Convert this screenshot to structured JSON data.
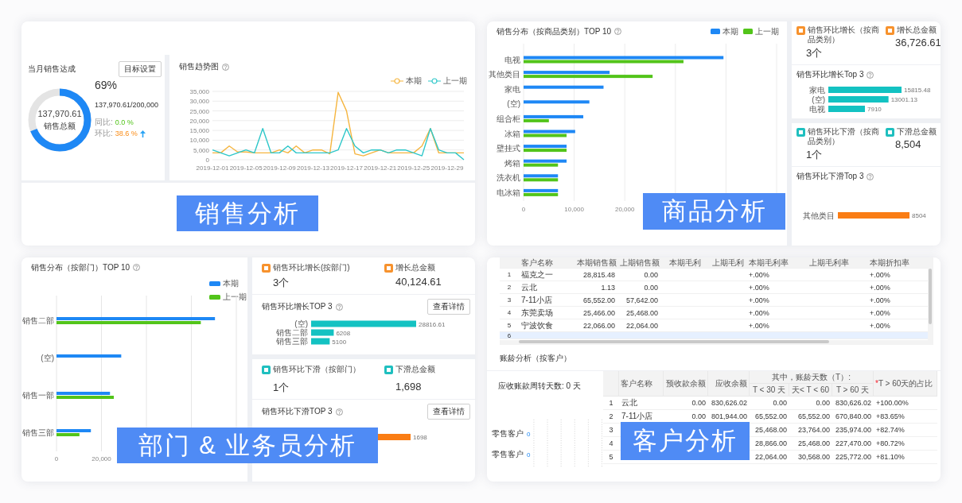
{
  "sales": {
    "caption": "销售分析",
    "target": {
      "title": "当月销售达成",
      "button": "目标设置",
      "level": 0.69,
      "total": "137,970.61",
      "total_label": "销售总额",
      "percent": "69%",
      "progress": "137,970.61/200,000",
      "comparisons": [
        {
          "label": "同比:",
          "value": "0.0 %",
          "up": false
        },
        {
          "label": "环比:",
          "value": "38.6 %",
          "up": true
        }
      ]
    },
    "trend": {
      "title": "销售趋势图",
      "chart_data": {
        "type": "line",
        "categories": [
          "2019-12-01",
          null,
          null,
          null,
          "2019-12-05",
          null,
          null,
          null,
          "2019-12-09",
          null,
          null,
          null,
          "2019-12-13",
          null,
          null,
          null,
          "2019-12-17",
          null,
          null,
          null,
          "2019-12-21",
          null,
          null,
          null,
          "2019-12-25",
          null,
          null,
          null,
          "2019-12-29",
          null,
          null
        ],
        "series": [
          {
            "name": "本期",
            "color": "#f5b53f",
            "values": [
              3500,
              3500,
              7000,
              4000,
              4000,
              3500,
              3500,
              3500,
              5000,
              3500,
              7000,
              3500,
              5000,
              5000,
              3000,
              34500,
              25000,
              3000,
              2000,
              3500,
              5000,
              3500,
              3500,
              3500,
              3500,
              7000,
              16000,
              3500,
              3500,
              3500,
              3500
            ]
          },
          {
            "name": "上一期",
            "color": "#2ec7c9",
            "values": [
              5000,
              3500,
              2000,
              3500,
              5000,
              3500,
              16000,
              3500,
              3500,
              7000,
              3500,
              3500,
              3500,
              3500,
              3500,
              5000,
              16000,
              7000,
              3500,
              5000,
              5000,
              3500,
              5000,
              5000,
              3500,
              2000,
              16000,
              5000,
              3500,
              3500,
              0
            ]
          }
        ],
        "ylim": [
          0,
          35000
        ],
        "grid": true,
        "yticks": [
          {
            "value": 0,
            "label": "0"
          },
          {
            "value": 5000,
            "label": "5,000"
          },
          {
            "value": 10000,
            "label": "10,000"
          },
          {
            "value": 15000,
            "label": "15,000"
          },
          {
            "value": 20000,
            "label": "20,000"
          },
          {
            "value": 25000,
            "label": "25,000"
          },
          {
            "value": 30000,
            "label": "30,000"
          },
          {
            "value": 35000,
            "label": "35,000"
          }
        ]
      }
    }
  },
  "products": {
    "caption": "商品分析",
    "distribution": {
      "title": "销售分布（按商品类别）TOP 10",
      "chart_data": {
        "type": "bar",
        "orientation": "horizontal",
        "categories": [
          "电视",
          "其他类目",
          "家电",
          "(空)",
          "组合柜",
          "冰箱",
          "壁挂式",
          "烤箱",
          "洗衣机",
          "电冰箱"
        ],
        "series": [
          {
            "name": "本期",
            "color": "#1e88f5",
            "values": [
              39500,
              17000,
              15800,
              13000,
              11800,
              10200,
              8500,
              8500,
              6800,
              6800
            ]
          },
          {
            "name": "上一期",
            "color": "#52c41a",
            "values": [
              31600,
              25500,
              null,
              null,
              5000,
              8500,
              8500,
              6800,
              6800,
              6800
            ]
          }
        ],
        "xlim": [
          0,
          50000
        ],
        "xticks": [
          {
            "value": 0,
            "label": "0"
          },
          {
            "value": 10000,
            "label": "10,000"
          },
          {
            "value": 20000,
            "label": "20,000"
          }
        ]
      }
    },
    "growth": {
      "declining": false,
      "count_label": "销售环比增长（按商品类别）",
      "amount_label": "增长总金额",
      "count": "3个",
      "amount": "36,726.61",
      "top_title": "销售环比增长Top 3",
      "chart_data": {
        "type": "bar",
        "orientation": "horizontal",
        "categories": [
          "家电",
          "(空)",
          "电视"
        ],
        "series": [
          {
            "color": "#13c2c2",
            "values": [
              15815.48,
              13001.13,
              7910
            ]
          }
        ],
        "data_labels": true
      }
    },
    "decline": {
      "declining": true,
      "count_label": "销售环比下滑（按商品类别）",
      "amount_label": "下滑总金额",
      "count": "1个",
      "amount": "8,504",
      "top_title": "销售环比下滑Top 3",
      "chart_data": {
        "type": "bar",
        "orientation": "horizontal",
        "categories": [
          "其他类目"
        ],
        "series": [
          {
            "color": "#fa7d14",
            "values": [
              8504
            ]
          }
        ],
        "data_labels": true
      }
    }
  },
  "departments": {
    "caption": "部门 & 业务员分析",
    "distribution": {
      "title": "销售分布（按部门）TOP 10",
      "chart_data": {
        "type": "bar",
        "orientation": "horizontal",
        "categories": [
          "销售二部",
          "(空)",
          "销售一部",
          "销售三部"
        ],
        "series": [
          {
            "name": "本期",
            "color": "#1e88f5",
            "values": [
              70500,
              28800,
              23800,
              15300
            ]
          },
          {
            "name": "上一期",
            "color": "#52c41a",
            "values": [
              64200,
              null,
              25500,
              10200
            ]
          }
        ],
        "xlim": [
          0,
          80000
        ],
        "xticks": [
          {
            "value": 0,
            "label": "0"
          },
          {
            "value": 20000,
            "label": "20,000"
          }
        ]
      }
    },
    "growth": {
      "declining": false,
      "count_label": "销售环比增长(按部门)",
      "amount_label": "增长总金额",
      "count": "3个",
      "amount": "40,124.61",
      "top_title": "销售环比增长TOP 3",
      "detail_button": "查看详情",
      "chart_data": {
        "type": "bar",
        "orientation": "horizontal",
        "categories": [
          "(空)",
          "销售二部",
          "销售三部"
        ],
        "series": [
          {
            "color": "#13c2c2",
            "values": [
              28816.61,
              6208,
              5100
            ]
          }
        ],
        "data_labels": true
      }
    },
    "decline": {
      "declining": true,
      "count_label": "销售环比下滑（按部门）",
      "amount_label": "下滑总金额",
      "count": "1个",
      "amount": "1,698",
      "top_title": "销售环比下滑TOP 3",
      "detail_button": "查看详情",
      "top_value": "1698"
    }
  },
  "customers": {
    "caption": "客户分析",
    "sales_table": {
      "columns": [
        "客户名称",
        "本期销售额",
        "上期销售额",
        "本期毛利",
        "上期毛利",
        "本期毛利率",
        "上期毛利率",
        "本期折扣率"
      ],
      "rows": [
        {
          "index": "1",
          "selected": false,
          "cells": [
            "福克之一",
            "28,815.48",
            "0.00",
            null,
            null,
            "+.00%",
            null,
            "+.00%"
          ]
        },
        {
          "index": "2",
          "selected": false,
          "cells": [
            "云北",
            "1.13",
            "0.00",
            null,
            null,
            "+.00%",
            null,
            "+.00%"
          ]
        },
        {
          "index": "3",
          "selected": false,
          "cells": [
            "7-11小店",
            "65,552.00",
            "57,642.00",
            null,
            null,
            "+.00%",
            null,
            "+.00%"
          ]
        },
        {
          "index": "4",
          "selected": false,
          "cells": [
            "东莞卖场",
            "25,466.00",
            "25,468.00",
            null,
            null,
            "+.00%",
            null,
            "+.00%"
          ]
        },
        {
          "index": "5",
          "selected": false,
          "cells": [
            "宁波饮食",
            "22,066.00",
            "22,064.00",
            null,
            null,
            "+.00%",
            null,
            "+.00%"
          ]
        },
        {
          "index": "6",
          "selected": true
        }
      ]
    },
    "aging": {
      "title": "账龄分析（按客户）",
      "turnover": "应收账款周转天数: 0 天",
      "segments": [
        {
          "label": "零售客户",
          "value": "0"
        },
        {
          "label": "零售客户",
          "value": "0"
        }
      ],
      "table": {
        "columns": [
          "客户名称",
          "预收款余额",
          "应收余额"
        ],
        "group": "其中，账龄天数（T）:",
        "subcolumns": [
          "T < 30 天",
          "天< T < 60",
          "T > 60 天"
        ],
        "ratio_mark": "*",
        "ratio_label": "T > 60天的占比",
        "rows": [
          {
            "index": "1",
            "cells": [
              "云北",
              "0.00",
              "830,626.02",
              "0.00",
              "0.00",
              "830,626.02",
              "+100.00%"
            ]
          },
          {
            "index": "2",
            "cells": [
              "7-11小店",
              "0.00",
              "801,944.00",
              "65,552.00",
              "65,552.00",
              "670,840.00",
              "+83.65%"
            ]
          },
          {
            "index": "3",
            "cells": [
              null,
              null,
              null,
              "25,468.00",
              "23,764.00",
              "235,974.00",
              "+82.74%"
            ]
          },
          {
            "index": "4",
            "cells": [
              null,
              null,
              null,
              "28,866.00",
              "25,468.00",
              "227,470.00",
              "+80.72%"
            ]
          },
          {
            "index": "5",
            "cells": [
              null,
              null,
              null,
              "22,064.00",
              "30,568.00",
              "225,772.00",
              "+81.10%"
            ]
          }
        ]
      }
    }
  }
}
